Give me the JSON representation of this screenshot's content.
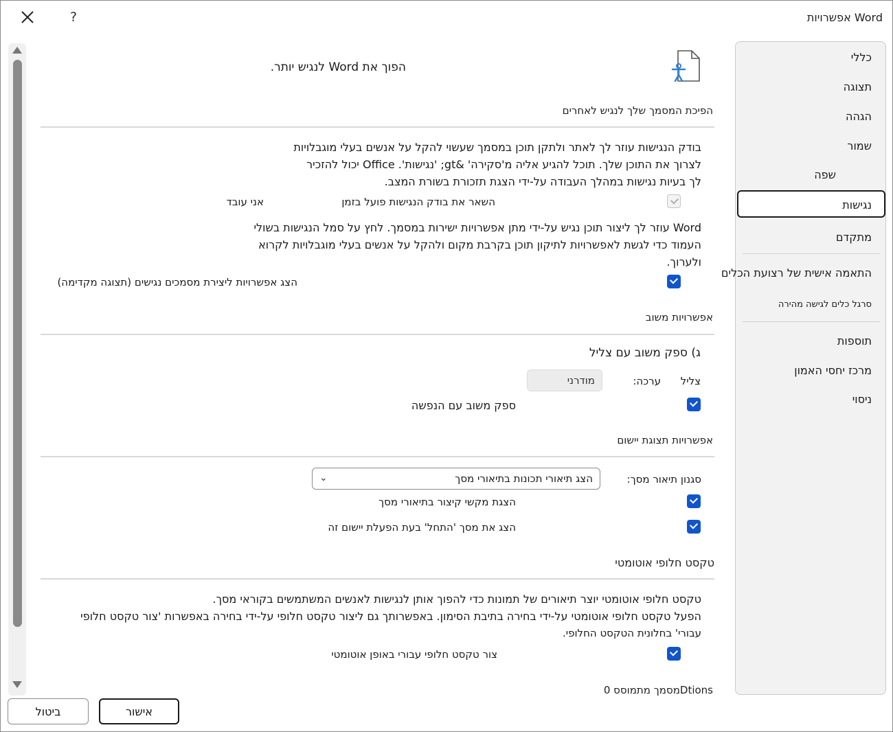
{
  "window": {
    "title": "אפשרויות Word",
    "help_label": "?"
  },
  "sidebar": {
    "items": [
      {
        "label": "כללי"
      },
      {
        "label": "תצוגה"
      },
      {
        "label": "הגהה"
      },
      {
        "label": "שמור"
      },
      {
        "label": "שפה"
      },
      {
        "label": "נגישות",
        "selected": true
      },
      {
        "label": "מתקדם"
      },
      {
        "label": "התאמה אישית של רצועת הכלים"
      },
      {
        "label": "סרגל כלים לגישה מהירה"
      },
      {
        "label": "תוספות"
      },
      {
        "label": "מרכז יחסי האמון"
      },
      {
        "label": "ניסוי"
      }
    ]
  },
  "header": {
    "heading": "הפוך את Word לנגיש יותר."
  },
  "section_accessible": {
    "title": "הפיכת המסמך שלך לנגיש לאחרים",
    "para_lines": [
      "בודק הנגישות עוזר לך לאתר ולתקן תוכן במסמך שעשוי להקל על אנשים בעלי מוגבלויות",
      "לצרוך את התוכן שלך. תוכל להגיע אליה מ'סקירה' &gt; 'נגישות'. Office יכול להזכיר",
      "לך בעיות נגישות במהלך העבודה על-ידי הצגת תזכורת בשורת המצב."
    ],
    "keep_checker_label": "השאר את בודק הנגישות פועל בזמן",
    "keep_checker_checked": false,
    "keep_checker_suffix": "אני עובד",
    "para2_lines": [
      "Word עוזר לך ליצור תוכן נגיש על-ידי מתן אפשרויות ישירות במסמך. לחץ על סמל הנגישות בשולי",
      "העמוד כדי לגשת לאפשרויות לתיקון תוכן בקרבת מקום ולהקל על אנשים בעלי מוגבלויות לקרוא",
      "ולערוך."
    ],
    "show_options_label": "הצג  אפשרויות  ליצירת  מסמכים  נגישים  (תצוגה  מקדימה)",
    "show_options_checked": true
  },
  "section_feedback": {
    "title": "אפשרויות משוב",
    "sound_heading": "ג) ספק משוב עם צליל",
    "sound_label": "צליל",
    "theme_label": "ערכה:",
    "theme_value": "מודרני",
    "animation_label": "ספק משוב עם הנפשה",
    "animation_checked": true
  },
  "section_display": {
    "title": "אפשרויות תצוגת יישום",
    "screentip_style_label": "סגנון תיאור מסך:",
    "screentip_style_value": "הצג תיאורי תכונות בתיאורי מסך",
    "shortcut_label": "הצגת מקשי קיצור בתיאורי מסך",
    "shortcut_checked": true,
    "start_screen_label": "הצג את מסך 'התחל' בעת הפעלת יישום זה",
    "start_screen_checked": true
  },
  "section_alt": {
    "title": "טקסט חלופי אוטומטי",
    "para_lines": [
      "טקסט חלופי אוטומטי יוצר תיאורים של תמונות כדי להפוך אותן לנגישות לאנשים המשתמשים בקוראי מסך.",
      "הפעל טקסט חלופי אוטומטי על-ידי בחירה בתיבת הסימון. באפשרותך גם ליצור טקסט חלופי על-ידי בחירה באפשרות 'צור טקסט חלופי",
      "עבורי' בחלונית הטקסט החלופי."
    ],
    "auto_alt_label": "צור טקסט חלופי עבורי באופן אוטומטי",
    "auto_alt_checked": true
  },
  "section_doc": {
    "title": "מסמך מתמוסס 0Dtions"
  },
  "footer": {
    "ok_label": "אישור",
    "cancel_label": "ביטול"
  }
}
